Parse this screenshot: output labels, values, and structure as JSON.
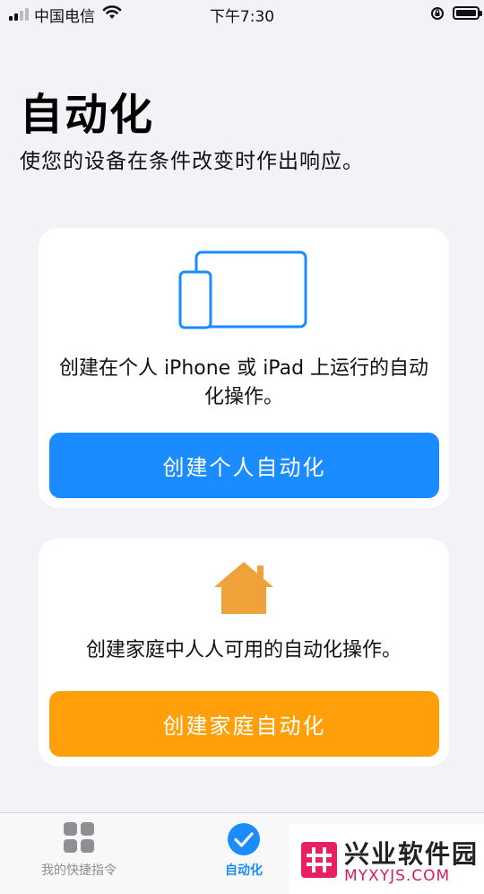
{
  "status_bar": {
    "carrier": "中国电信",
    "time": "下午7:30"
  },
  "page": {
    "title": "自动化",
    "subtitle": "使您的设备在条件改变时作出响应。"
  },
  "personal_card": {
    "icon": "iphone-ipad-icon",
    "description": "创建在个人 iPhone 或 iPad 上运行的自动化操作。",
    "button_label": "创建个人自动化",
    "button_color": "#1a8cff"
  },
  "home_card": {
    "icon": "house-icon",
    "description": "创建家庭中人人可用的自动化操作。",
    "button_label": "创建家庭自动化",
    "button_color": "#ff9f0a"
  },
  "tab_bar": {
    "tabs": [
      {
        "label": "我的快捷指令",
        "icon": "grid-icon",
        "active": false
      },
      {
        "label": "自动化",
        "icon": "checkmark-circle-icon",
        "active": true
      },
      {
        "label": "",
        "icon": "gallery-icon",
        "active": false
      }
    ]
  },
  "watermark": {
    "title": "兴业软件园",
    "url": "MYXYJS.COM"
  },
  "colors": {
    "accent": "#1a8cff",
    "home_orange": "#ff9f0a",
    "background": "#f2f2f7"
  }
}
